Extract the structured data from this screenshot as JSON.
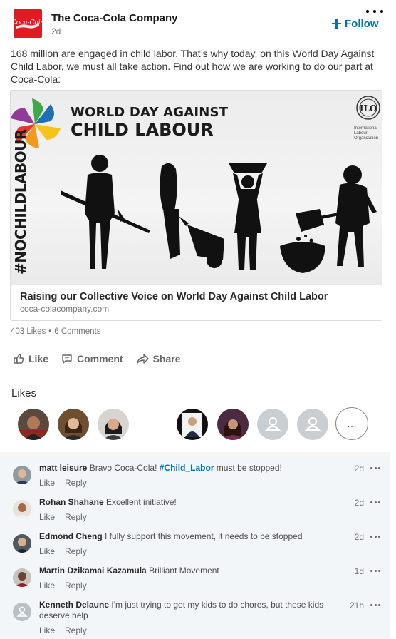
{
  "post": {
    "company": "The Coca-Cola Company",
    "logo_text": "Coca-Cola",
    "age": "2d",
    "follow_label": "Follow",
    "text": "168 million are engaged in child labor. That’s why today, on this World Day Against Child Labor, we must all take action.  Find out how we are working to do our part at Coca-Cola:",
    "brand_color": "#e01b22",
    "accent_color": "#0073b1"
  },
  "card": {
    "image_title_line1": "WORLD DAY AGAINST",
    "image_title_line2": "CHILD LABOUR",
    "image_hashtag": "#NOCHILDLABOUR",
    "ilo_logo_text": "ILO",
    "ilo_caption": "International Labour Organization",
    "title": "Raising our Collective Voice on World Day Against Child Labor",
    "domain": "coca-colacompany.com"
  },
  "social": {
    "likes_count": "403 Likes",
    "separator": "•",
    "comments_count": "6 Comments"
  },
  "actions": {
    "like": "Like",
    "comment": "Comment",
    "share": "Share"
  },
  "likes_section": {
    "heading": "Likes",
    "more": "…"
  },
  "comments": [
    {
      "name": "matt leisure",
      "text_before": "Bravo Coca-Cola!",
      "tag": "#Child_Labor",
      "text_after": "must be stopped!",
      "time": "2d",
      "like": "Like",
      "reply": "Reply"
    },
    {
      "name": "Rohan Shahane",
      "text_before": "Excellent initiative!",
      "tag": "",
      "text_after": "",
      "time": "2d",
      "like": "Like",
      "reply": "Reply"
    },
    {
      "name": "Edmond Cheng",
      "text_before": "I fully support this movement, it needs to be stopped",
      "tag": "",
      "text_after": "",
      "time": "2d",
      "like": "Like",
      "reply": "Reply"
    },
    {
      "name": "Martin Dzikamai Kazamula",
      "text_before": "Brilliant Movement",
      "tag": "",
      "text_after": "",
      "time": "1d",
      "like": "Like",
      "reply": "Reply"
    },
    {
      "name": "Kenneth Delaune",
      "text_before": "I'm just trying to get my kids to do chores, but these kids deserve help",
      "tag": "",
      "text_after": "",
      "time": "21h",
      "like": "Like",
      "reply": "Reply"
    }
  ]
}
